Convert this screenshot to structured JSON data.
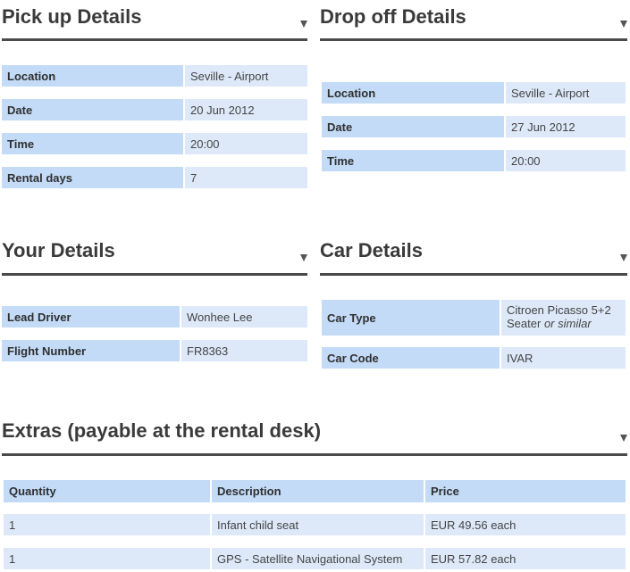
{
  "pickup": {
    "title": "Pick up Details",
    "rows": [
      {
        "label": "Location",
        "value": "Seville - Airport"
      },
      {
        "label": "Date",
        "value": "20 Jun 2012"
      },
      {
        "label": "Time",
        "value": "20:00"
      },
      {
        "label": "Rental days",
        "value": "7"
      }
    ]
  },
  "dropoff": {
    "title": "Drop off Details",
    "rows": [
      {
        "label": "Location",
        "value": "Seville - Airport"
      },
      {
        "label": "Date",
        "value": "27 Jun 2012"
      },
      {
        "label": "Time",
        "value": "20:00"
      }
    ]
  },
  "your_details": {
    "title": "Your Details",
    "rows": [
      {
        "label": "Lead Driver",
        "value": "Wonhee Lee"
      },
      {
        "label": "Flight Number",
        "value": "FR8363"
      }
    ]
  },
  "car_details": {
    "title": "Car Details",
    "rows": [
      {
        "label": "Car Type",
        "value": "Citroen Picasso 5+2 Seater",
        "value_suffix": "or similar"
      },
      {
        "label": "Car Code",
        "value": "IVAR"
      }
    ]
  },
  "extras": {
    "title": "Extras (payable at the rental desk)",
    "columns": [
      "Quantity",
      "Description",
      "Price"
    ],
    "rows": [
      [
        "1",
        "Infant child seat",
        "EUR 49.56 each"
      ],
      [
        "1",
        "GPS - Satellite Navigational System",
        "EUR 57.82 each"
      ]
    ]
  },
  "colors": {
    "label_bg": "#c3dbf7",
    "value_bg": "#dde9f9",
    "rule": "#4a4a4a"
  },
  "icons": {
    "section_toggle": "triangle-down-icon"
  }
}
